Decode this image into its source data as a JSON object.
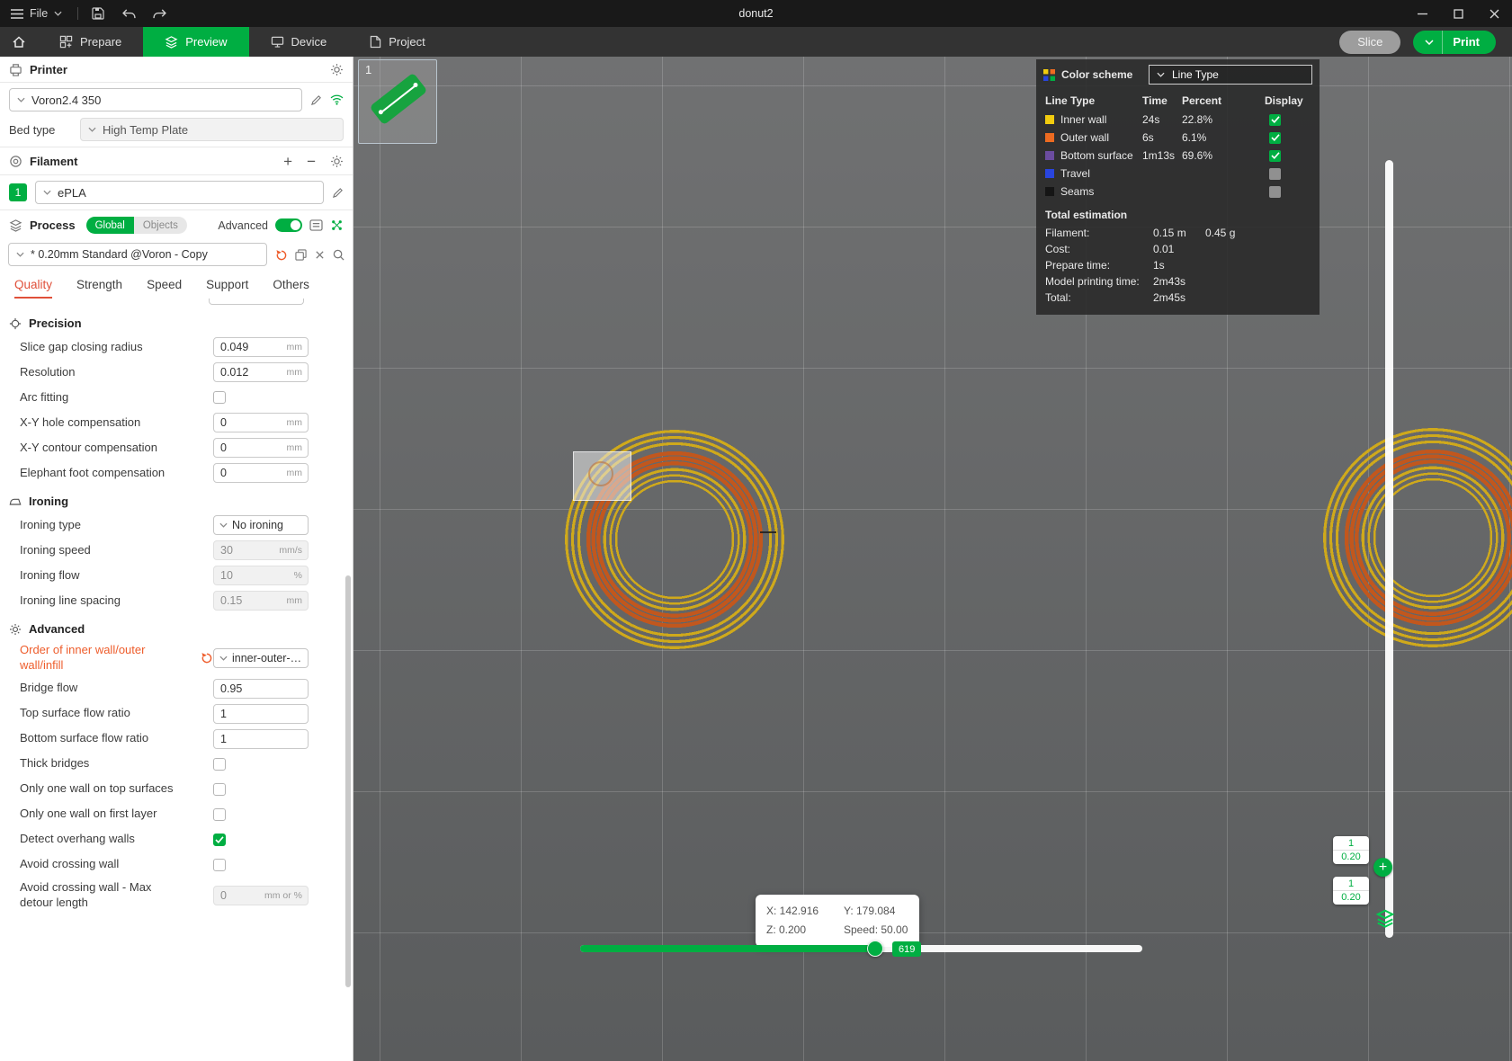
{
  "accent_color": "#00AE42",
  "modified_color": "#EE5D2C",
  "titlebar": {
    "file_label": "File",
    "title": "donut2"
  },
  "navbar": {
    "tabs": [
      {
        "label": "Prepare"
      },
      {
        "label": "Preview"
      },
      {
        "label": "Device"
      },
      {
        "label": "Project"
      }
    ],
    "active_tab": "Preview",
    "slice_label": "Slice",
    "print_label": "Print"
  },
  "sidebar": {
    "printer": {
      "section_title": "Printer",
      "name": "Voron2.4 350",
      "bed_type_label": "Bed type",
      "bed_type_value": "High Temp Plate"
    },
    "filament": {
      "section_title": "Filament",
      "index": "1",
      "name": "ePLA"
    },
    "process": {
      "section_title": "Process",
      "global_label": "Global",
      "objects_label": "Objects",
      "advanced_label": "Advanced",
      "preset": "* 0.20mm Standard @Voron - Copy",
      "tabs": [
        "Quality",
        "Strength",
        "Speed",
        "Support",
        "Others"
      ],
      "active_tab": "Quality"
    },
    "groups": [
      {
        "title": "Precision",
        "icon": "precision-icon",
        "rows": [
          {
            "label": "Slice gap closing radius",
            "type": "input",
            "value": "0.049",
            "unit": "mm"
          },
          {
            "label": "Resolution",
            "type": "input",
            "value": "0.012",
            "unit": "mm"
          },
          {
            "label": "Arc fitting",
            "type": "checkbox",
            "checked": false
          },
          {
            "label": "X-Y hole compensation",
            "type": "input",
            "value": "0",
            "unit": "mm"
          },
          {
            "label": "X-Y contour compensation",
            "type": "input",
            "value": "0",
            "unit": "mm"
          },
          {
            "label": "Elephant foot compensation",
            "type": "input",
            "value": "0",
            "unit": "mm"
          }
        ]
      },
      {
        "title": "Ironing",
        "icon": "ironing-icon",
        "rows": [
          {
            "label": "Ironing type",
            "type": "select",
            "value": "No ironing"
          },
          {
            "label": "Ironing speed",
            "type": "input",
            "value": "30",
            "unit": "mm/s",
            "disabled": true
          },
          {
            "label": "Ironing flow",
            "type": "input",
            "value": "10",
            "unit": "%",
            "disabled": true
          },
          {
            "label": "Ironing line spacing",
            "type": "input",
            "value": "0.15",
            "unit": "mm",
            "disabled": true
          }
        ]
      },
      {
        "title": "Advanced",
        "icon": "advanced-gear-icon",
        "rows": [
          {
            "label": "Order of inner wall/outer wall/infill",
            "type": "select",
            "value": "inner-outer-…",
            "modified": true
          },
          {
            "label": "Bridge flow",
            "type": "input",
            "value": "0.95"
          },
          {
            "label": "Top surface flow ratio",
            "type": "input",
            "value": "1"
          },
          {
            "label": "Bottom surface flow ratio",
            "type": "input",
            "value": "1"
          },
          {
            "label": "Thick bridges",
            "type": "checkbox",
            "checked": false
          },
          {
            "label": "Only one wall on top surfaces",
            "type": "checkbox",
            "checked": false
          },
          {
            "label": "Only one wall on first layer",
            "type": "checkbox",
            "checked": false
          },
          {
            "label": "Detect overhang walls",
            "type": "checkbox",
            "checked": true
          },
          {
            "label": "Avoid crossing wall",
            "type": "checkbox",
            "checked": false
          },
          {
            "label": "Avoid crossing wall - Max detour length",
            "type": "input",
            "value": "0",
            "unit": "mm or %",
            "disabled": true
          }
        ]
      }
    ]
  },
  "viewport": {
    "plate_number": "1",
    "legend": {
      "header": "Color scheme",
      "scheme_value": "Line Type",
      "columns": [
        "Line Type",
        "Time",
        "Percent",
        "Display"
      ],
      "rows": [
        {
          "name": "Inner wall",
          "color": "#F2CC0F",
          "time": "24s",
          "percent": "22.8%",
          "checked": true
        },
        {
          "name": "Outer wall",
          "color": "#ED6B21",
          "time": "6s",
          "percent": "6.1%",
          "checked": true
        },
        {
          "name": "Bottom surface",
          "color": "#6B4C9F",
          "time": "1m13s",
          "percent": "69.6%",
          "checked": true
        },
        {
          "name": "Travel",
          "color": "#2945DE",
          "time": "",
          "percent": "",
          "checked": false
        },
        {
          "name": "Seams",
          "color": "#151515",
          "time": "",
          "percent": "",
          "checked": false
        }
      ],
      "total_title": "Total estimation",
      "stats": [
        {
          "label": "Filament:",
          "value": "0.15 m",
          "value2": "0.45 g"
        },
        {
          "label": "Cost:",
          "value": "0.01"
        },
        {
          "label": "Prepare time:",
          "value": "1s"
        },
        {
          "label": "Model printing time:",
          "value": "2m43s"
        },
        {
          "label": "Total:",
          "value": "2m45s"
        }
      ]
    },
    "layer_badges": [
      {
        "top": "1",
        "bottom": "0.20"
      },
      {
        "top": "1",
        "bottom": "0.20"
      }
    ],
    "hslider_badge": "619",
    "tooltip": {
      "x": "X: 142.916",
      "y": "Y: 179.084",
      "z": "Z: 0.200",
      "speed": "Speed: 50.00"
    }
  }
}
